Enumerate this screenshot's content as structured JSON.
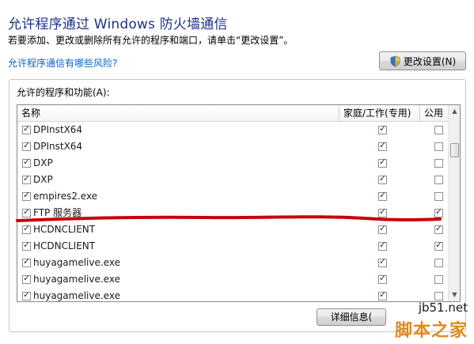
{
  "header": {
    "title": "允许程序通过 Windows 防火墙通信",
    "subtitle": "若要添加、更改或删除所有允许的程序和端口，请单击“更改设置”。",
    "risk_link": "允许程序通信有哪些风险?",
    "change_settings_label": "更改设置(N)",
    "change_settings_icon": "uac-shield-icon"
  },
  "group": {
    "label": "允许的程序和功能(A):",
    "columns": [
      "名称",
      "家庭/工作(专用)",
      "公用"
    ],
    "rows": [
      {
        "name": "DPInstX64",
        "enabled": true,
        "home": true,
        "public": false
      },
      {
        "name": "DPInstX64",
        "enabled": true,
        "home": true,
        "public": false
      },
      {
        "name": "DXP",
        "enabled": true,
        "home": true,
        "public": false
      },
      {
        "name": "DXP",
        "enabled": true,
        "home": true,
        "public": false
      },
      {
        "name": "empires2.exe",
        "enabled": true,
        "home": true,
        "public": false
      },
      {
        "name": "FTP 服务器",
        "enabled": true,
        "home": true,
        "public": true
      },
      {
        "name": "HCDNCLIENT",
        "enabled": true,
        "home": true,
        "public": true
      },
      {
        "name": "HCDNCLIENT",
        "enabled": true,
        "home": true,
        "public": true
      },
      {
        "name": "huyagamelive.exe",
        "enabled": true,
        "home": true,
        "public": false
      },
      {
        "name": "huyagamelive.exe",
        "enabled": true,
        "home": true,
        "public": false
      },
      {
        "name": "huyagamelive.exe",
        "enabled": true,
        "home": true,
        "public": false
      }
    ],
    "details_label": "详细信息(",
    "highlight_color": "#c8000a"
  },
  "watermark": {
    "url": "jb51.net",
    "text": "脚本之家",
    "color": "#e08a1e"
  }
}
